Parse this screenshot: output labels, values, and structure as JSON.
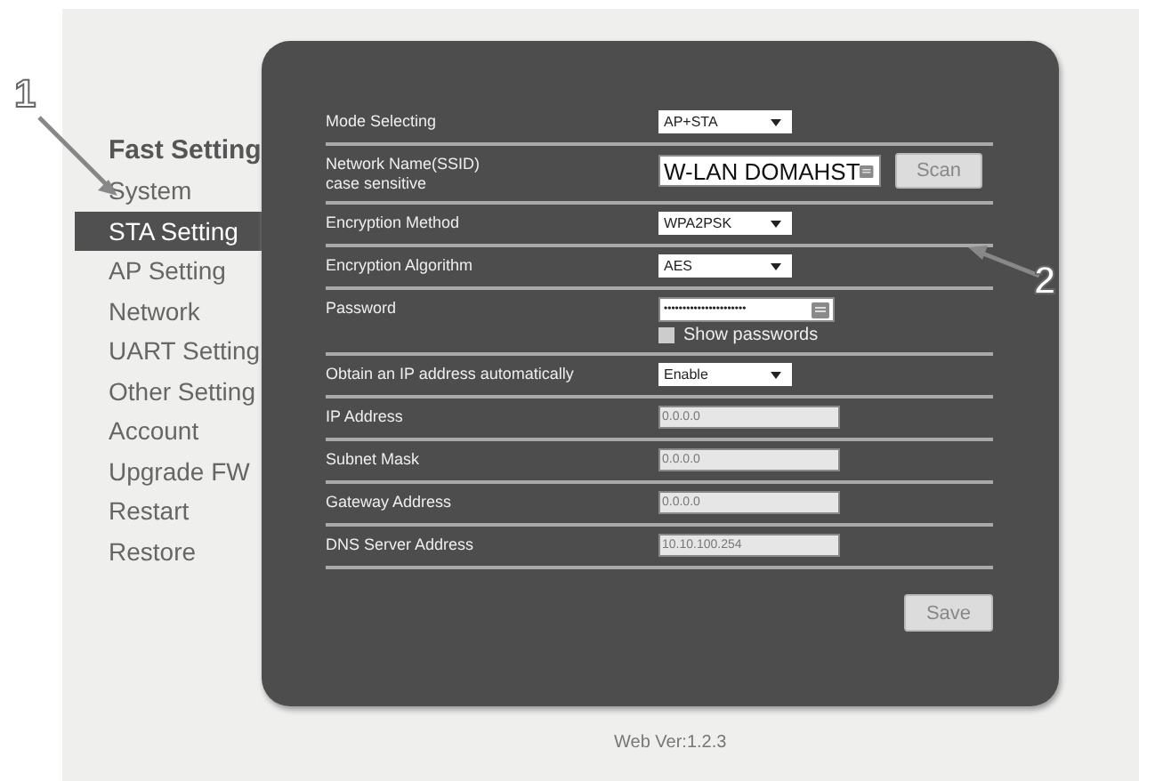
{
  "sidebar": {
    "title": "Fast Setting",
    "items": [
      {
        "label": "System",
        "selected": false
      },
      {
        "label": "STA Setting",
        "selected": true
      },
      {
        "label": "AP Setting",
        "selected": false
      },
      {
        "label": "Network",
        "selected": false
      },
      {
        "label": "UART Setting",
        "selected": false
      },
      {
        "label": "Other Setting",
        "selected": false
      },
      {
        "label": "Account",
        "selected": false
      },
      {
        "label": "Upgrade FW",
        "selected": false
      },
      {
        "label": "Restart",
        "selected": false
      },
      {
        "label": "Restore",
        "selected": false
      }
    ]
  },
  "form": {
    "rows": [
      {
        "kind": "select",
        "label": "Mode Selecting",
        "value": "AP+STA"
      },
      {
        "kind": "scan",
        "label": "Network Name(SSID)",
        "sublabel": "case sensitive",
        "value": "W-LAN DOMAHST",
        "button": "Scan"
      },
      {
        "kind": "select",
        "label": "Encryption Method",
        "value": "WPA2PSK"
      },
      {
        "kind": "select",
        "label": "Encryption Algorithm",
        "value": "AES"
      },
      {
        "kind": "password",
        "label": "Password",
        "value": "••••••••••••••••••••••",
        "checkbox": {
          "label": "Show passwords",
          "checked": false
        }
      },
      {
        "kind": "select",
        "label": "Obtain an IP address automatically",
        "value": "Enable"
      },
      {
        "kind": "disabled",
        "label": "IP Address",
        "value": "0.0.0.0"
      },
      {
        "kind": "disabled",
        "label": "Subnet Mask",
        "value": "0.0.0.0"
      },
      {
        "kind": "disabled",
        "label": "Gateway Address",
        "value": "0.0.0.0"
      },
      {
        "kind": "disabled",
        "label": "DNS Server Address",
        "value": "10.10.100.254"
      }
    ],
    "save_button": "Save"
  },
  "footer": "Web Ver:1.2.3",
  "annotations": [
    {
      "label": "1"
    },
    {
      "label": "2"
    }
  ]
}
